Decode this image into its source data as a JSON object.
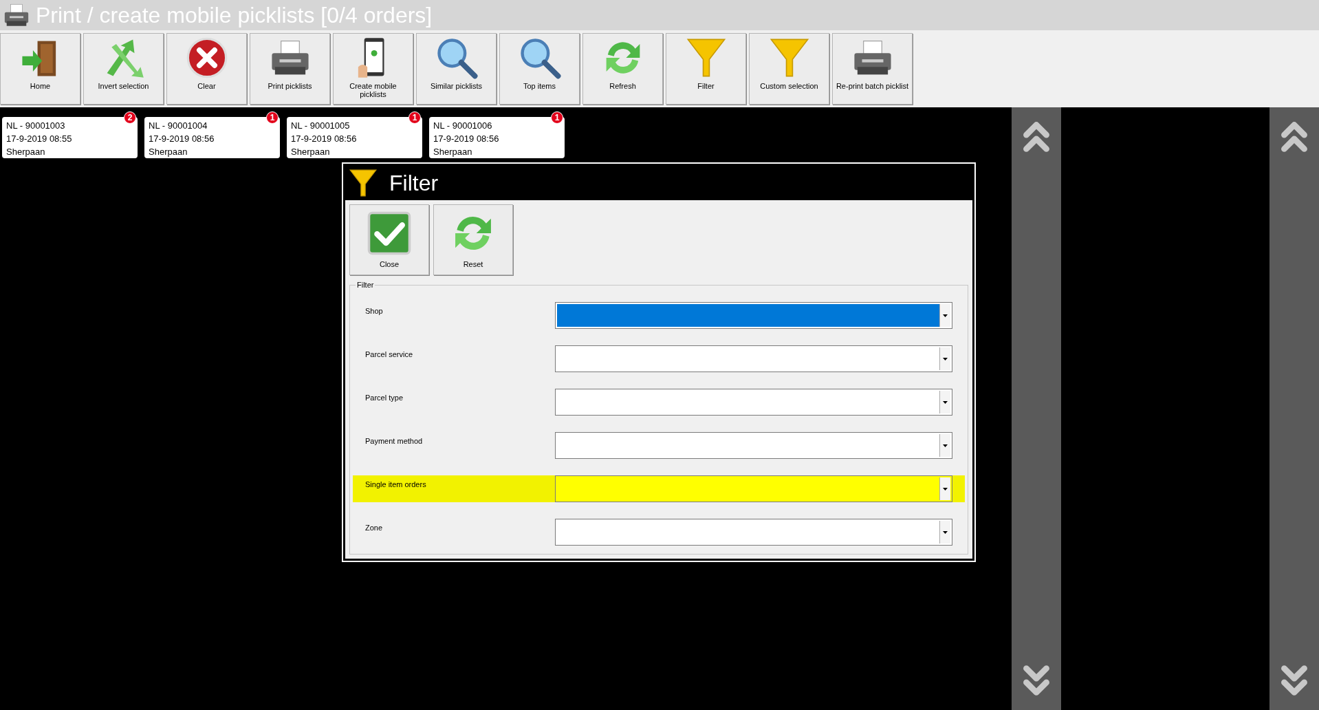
{
  "window": {
    "title": "Print / create mobile picklists [0/4 orders]"
  },
  "toolbar": [
    {
      "label": "Home",
      "kind": "door"
    },
    {
      "label": "Invert selection",
      "kind": "arrows"
    },
    {
      "label": "Clear",
      "kind": "clear"
    },
    {
      "label": "Print picklists",
      "kind": "printer"
    },
    {
      "label": "Create mobile picklists",
      "kind": "phone"
    },
    {
      "label": "Similar picklists",
      "kind": "magnifier"
    },
    {
      "label": "Top items",
      "kind": "magnifier"
    },
    {
      "label": "Refresh",
      "kind": "refresh"
    },
    {
      "label": "Filter",
      "kind": "funnel"
    },
    {
      "label": "Custom selection",
      "kind": "funnel"
    },
    {
      "label": "Re-print batch picklist",
      "kind": "printer"
    }
  ],
  "orders": [
    {
      "number": "NL - 90001003",
      "date": "17-9-2019 08:55",
      "shop": "Sherpaan",
      "badge": "2"
    },
    {
      "number": "NL - 90001004",
      "date": "17-9-2019 08:56",
      "shop": "Sherpaan",
      "badge": "1"
    },
    {
      "number": "NL - 90001005",
      "date": "17-9-2019 08:56",
      "shop": "Sherpaan",
      "badge": "1"
    },
    {
      "number": "NL - 90001006",
      "date": "17-9-2019 08:56",
      "shop": "Sherpaan",
      "badge": "1"
    }
  ],
  "dialog": {
    "title": "Filter",
    "buttons": [
      {
        "label": "Close",
        "kind": "check"
      },
      {
        "label": "Reset",
        "kind": "refresh"
      }
    ],
    "group": "Filter",
    "fields": [
      {
        "label": "Shop",
        "selected": true,
        "highlighted": false
      },
      {
        "label": "Parcel service",
        "selected": false,
        "highlighted": false
      },
      {
        "label": "Parcel type",
        "selected": false,
        "highlighted": false
      },
      {
        "label": "Payment method",
        "selected": false,
        "highlighted": false
      },
      {
        "label": "Single item orders",
        "selected": false,
        "highlighted": true
      },
      {
        "label": "Zone",
        "selected": false,
        "highlighted": false
      }
    ]
  }
}
